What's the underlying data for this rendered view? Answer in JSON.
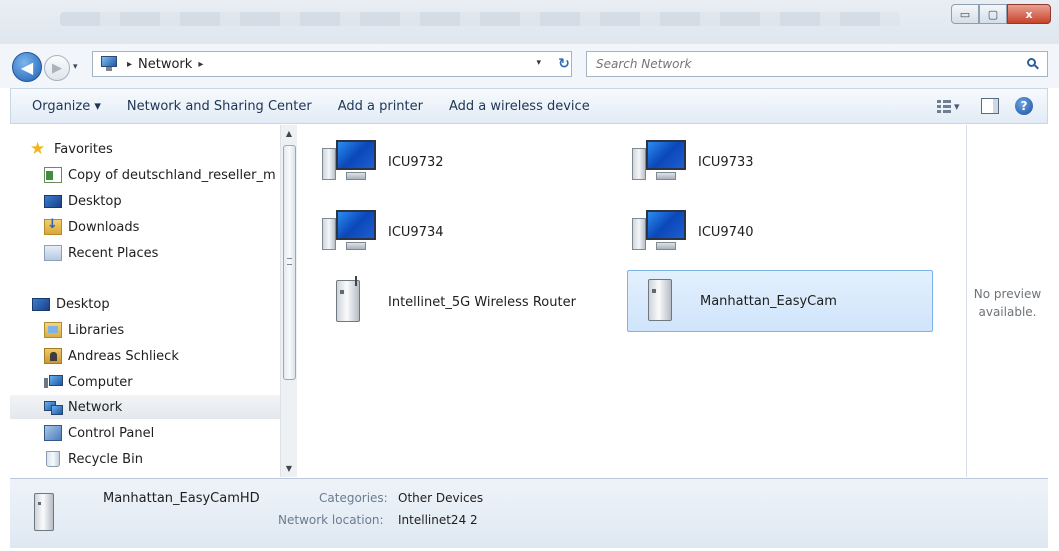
{
  "address": {
    "crumbs": [
      "Network"
    ],
    "sep": "▸",
    "dropdown": "▾"
  },
  "nav_buttons": {
    "back": "◀",
    "forward": "▶",
    "history": "▾",
    "refresh": "↻"
  },
  "search": {
    "placeholder": "Search Network"
  },
  "toolbar": {
    "organize": "Organize ▾",
    "network_sharing": "Network and Sharing Center",
    "add_printer": "Add a printer",
    "add_wireless": "Add a wireless device",
    "views_dropdown": "▾",
    "help": "?"
  },
  "window_buttons": {
    "minimize": "▭",
    "maximize": "▢",
    "close": "x"
  },
  "sidebar": {
    "items": [
      {
        "label": "Favorites",
        "icon": "star-icon"
      },
      {
        "label": "Copy of deutschland_reseller_m",
        "icon": "document-icon"
      },
      {
        "label": "Desktop",
        "icon": "desktop-icon"
      },
      {
        "label": "Downloads",
        "icon": "downloads-icon"
      },
      {
        "label": "Recent Places",
        "icon": "recent-places-icon"
      },
      {
        "label": "Desktop",
        "icon": "desktop-icon"
      },
      {
        "label": "Libraries",
        "icon": "libraries-icon"
      },
      {
        "label": "Andreas Schlieck",
        "icon": "user-folder-icon"
      },
      {
        "label": "Computer",
        "icon": "computer-icon"
      },
      {
        "label": "Network",
        "icon": "network-icon",
        "selected": true
      },
      {
        "label": "Control Panel",
        "icon": "control-panel-icon"
      },
      {
        "label": "Recycle Bin",
        "icon": "recycle-bin-icon"
      }
    ]
  },
  "scrollbar": {
    "up": "▲",
    "down": "▼"
  },
  "items": [
    {
      "label": "ICU9732",
      "icon": "computer-icon"
    },
    {
      "label": "ICU9733",
      "icon": "computer-icon"
    },
    {
      "label": "ICU9734",
      "icon": "computer-icon"
    },
    {
      "label": "ICU9740",
      "icon": "computer-icon"
    },
    {
      "label": "Intellinet_5G Wireless Router",
      "icon": "router-icon"
    },
    {
      "label": "Manhattan_EasyCam",
      "icon": "device-icon",
      "selected": true
    }
  ],
  "preview": {
    "line1": "No preview",
    "line2": "available."
  },
  "details": {
    "name": "Manhattan_EasyCamHD",
    "categories_label": "Categories:",
    "categories_value": "Other Devices",
    "location_label": "Network location:",
    "location_value": "Intellinet24  2"
  }
}
